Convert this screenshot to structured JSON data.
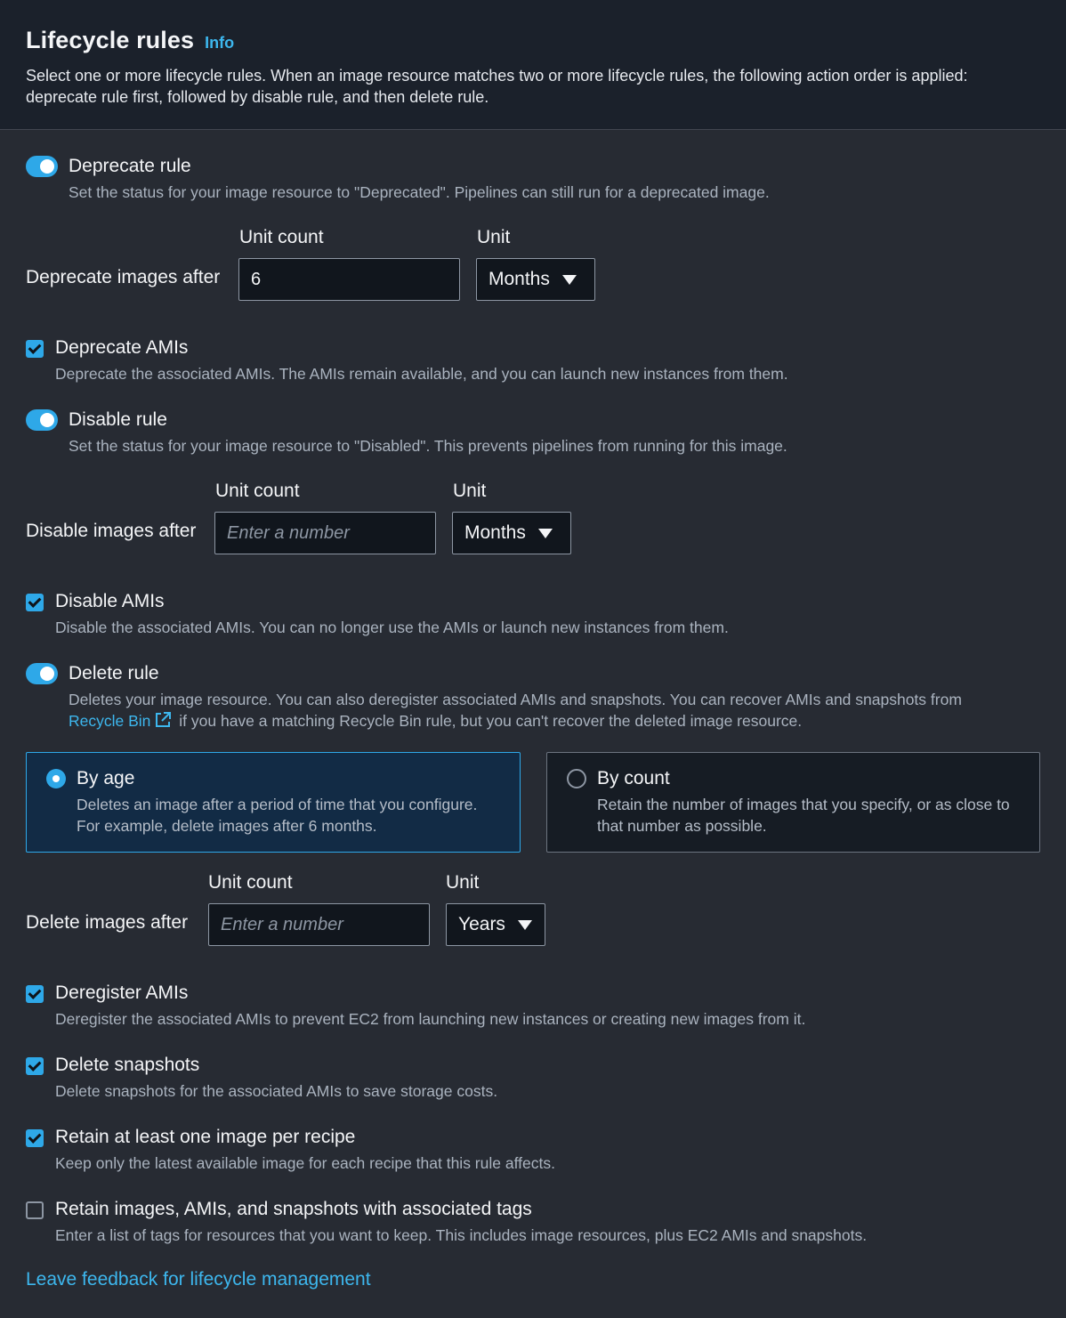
{
  "header": {
    "title": "Lifecycle rules",
    "info": "Info",
    "description": "Select one or more lifecycle rules. When an image resource matches two or more lifecycle rules, the following action order is applied: deprecate rule first, followed by disable rule, and then delete rule."
  },
  "deprecate": {
    "toggle_label": "Deprecate rule",
    "toggle_on": true,
    "toggle_desc": "Set the status for your image resource to \"Deprecated\". Pipelines can still run for a deprecated image.",
    "field_label": "Deprecate images after",
    "unit_count_label": "Unit count",
    "unit_count_value": "6",
    "unit_count_placeholder": "Enter a number",
    "unit_label": "Unit",
    "unit_value": "Months",
    "amis_label": "Deprecate AMIs",
    "amis_checked": true,
    "amis_desc": "Deprecate the associated AMIs. The AMIs remain available, and you can launch new instances from them."
  },
  "disable": {
    "toggle_label": "Disable rule",
    "toggle_on": true,
    "toggle_desc": "Set the status for your image resource to \"Disabled\". This prevents pipelines from running for this image.",
    "field_label": "Disable images after",
    "unit_count_label": "Unit count",
    "unit_count_value": "",
    "unit_count_placeholder": "Enter a number",
    "unit_label": "Unit",
    "unit_value": "Months",
    "amis_label": "Disable AMIs",
    "amis_checked": true,
    "amis_desc": "Disable the associated AMIs. You can no longer use the AMIs or launch new instances from them."
  },
  "delete": {
    "toggle_label": "Delete rule",
    "toggle_on": true,
    "toggle_desc_before": "Deletes your image resource. You can also deregister associated AMIs and snapshots. You can recover AMIs and snapshots from",
    "recycle_bin_link": "Recycle Bin",
    "toggle_desc_after": "if you have a matching Recycle Bin rule, but you can't recover the deleted image resource.",
    "by_age": {
      "label": "By age",
      "selected": true,
      "desc": "Deletes an image after a period of time that you configure. For example, delete images after 6 months."
    },
    "by_count": {
      "label": "By count",
      "selected": false,
      "desc": "Retain the number of images that you specify, or as close to that number as possible."
    },
    "field_label": "Delete images after",
    "unit_count_label": "Unit count",
    "unit_count_value": "",
    "unit_count_placeholder": "Enter a number",
    "unit_label": "Unit",
    "unit_value": "Years",
    "options": [
      {
        "label": "Deregister AMIs",
        "checked": true,
        "desc": "Deregister the associated AMIs to prevent EC2 from launching new instances or creating new images from it."
      },
      {
        "label": "Delete snapshots",
        "checked": true,
        "desc": "Delete snapshots for the associated AMIs to save storage costs."
      },
      {
        "label": "Retain at least one image per recipe",
        "checked": true,
        "desc": "Keep only the latest available image for each recipe that this rule affects."
      },
      {
        "label": "Retain images, AMIs, and snapshots with associated tags",
        "checked": false,
        "desc": "Enter a list of tags for resources that you want to keep. This includes image resources, plus EC2 AMIs and snapshots."
      }
    ]
  },
  "feedback_link": "Leave feedback for lifecycle management",
  "colors": {
    "accent": "#2ea8e8",
    "link": "#3db7ee",
    "background": "#272b33",
    "header_background": "#1b212b"
  }
}
